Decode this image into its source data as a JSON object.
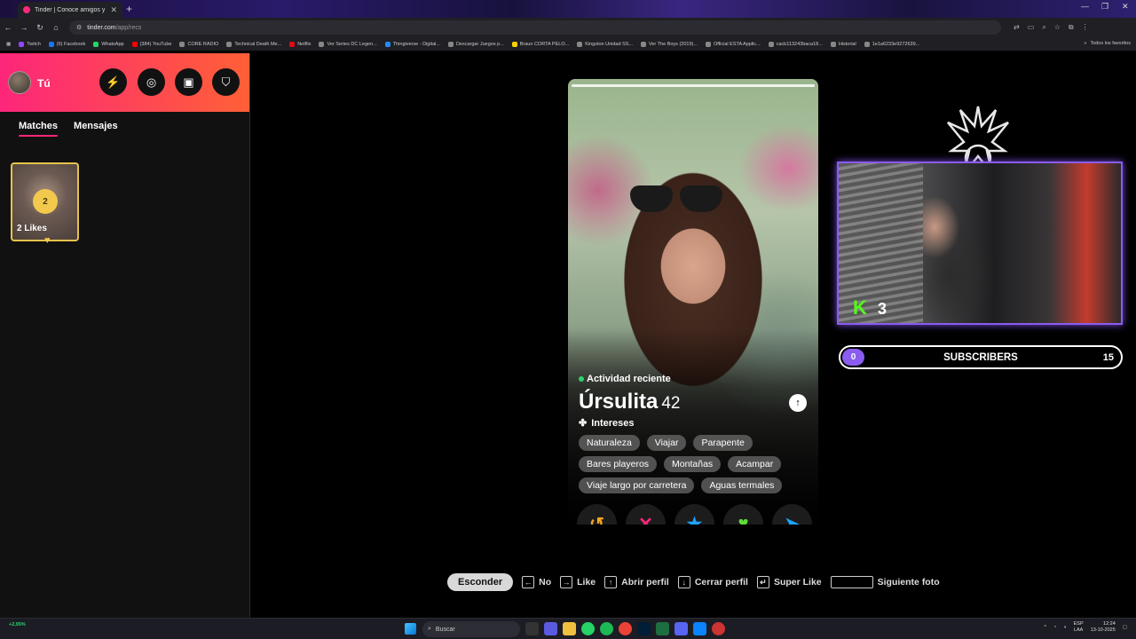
{
  "browser": {
    "tab_title": "Tinder | Conoce amigos y gen",
    "url_host": "tinder.com",
    "url_path": "/app/recs",
    "bookmarks": [
      "Twitch",
      "(6) Facebook",
      "WhatsApp",
      "(384) YouTube",
      "CORE RADIO",
      "Technical Death Me...",
      "Netflix",
      "Ver Series DC Legen...",
      "Thingiverse - Digital...",
      "Descargar Juegos p...",
      "Braun CORTA PELO...",
      "Kingston Unidad SS...",
      "Ver The Boys (2019)...",
      "Official ESTA Applic...",
      "cacb113243baca18...",
      "Historial",
      "1e1a6233e9272639..."
    ],
    "bookmarks_all": "Todos los favoritos"
  },
  "sidebar": {
    "user_name": "Tú",
    "tabs": [
      "Matches",
      "Mensajes"
    ],
    "likes_count": "2",
    "likes_label": "2 Likes"
  },
  "profile": {
    "activity": "Actividad reciente",
    "name": "Úrsulita",
    "age": "42",
    "interests_title": "Intereses",
    "interests": [
      "Naturaleza",
      "Viajar",
      "Parapente",
      "Bares playeros",
      "Montañas",
      "Acampar",
      "Viaje largo por carretera",
      "Aguas termales"
    ]
  },
  "actions": {
    "rewind_icon": "↺",
    "nope_icon": "✕",
    "superlike_icon": "★",
    "like_icon": "♥",
    "boost_icon": "➤"
  },
  "hints": {
    "hide": "Esconder",
    "no": "No",
    "like": "Like",
    "open_profile": "Abrir perfil",
    "close_profile": "Cerrar perfil",
    "super_like": "Super Like",
    "next_photo": "Siguiente foto"
  },
  "stream": {
    "cam_number": "3",
    "subs_current": "0",
    "subs_label": "SUBSCRIBERS",
    "subs_goal": "15"
  },
  "taskbar": {
    "search": "Buscar",
    "stock_change": "+2,95%",
    "lang": "ESP",
    "lang_sub": "LAA",
    "time": "12:24",
    "date": "13-10-2025"
  },
  "colors": {
    "tinder_gradient_start": "#fd267a",
    "tinder_gradient_end": "#ff6036",
    "likes_gold": "#f2c94c",
    "stream_purple": "#8a5cf0"
  }
}
